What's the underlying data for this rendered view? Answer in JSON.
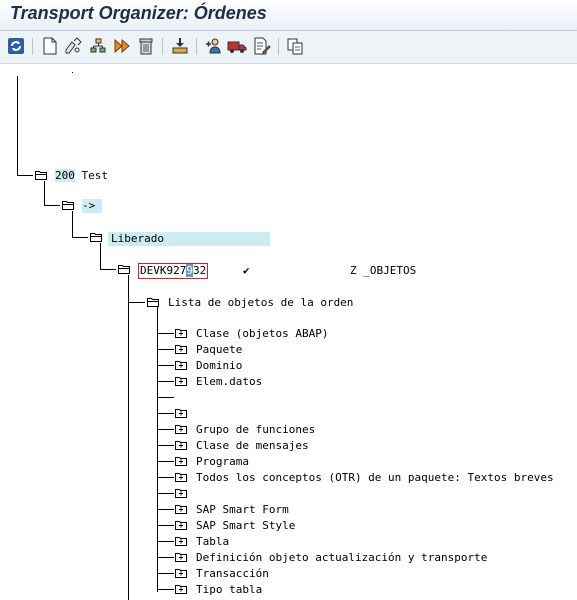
{
  "window": {
    "title": "Transport Organizer: Órdenes"
  },
  "toolbar": [
    {
      "name": "refresh-icon"
    },
    {
      "name": "new-document-icon"
    },
    {
      "name": "display-change-icon"
    },
    {
      "name": "hierarchy-icon"
    },
    {
      "name": "release-icon"
    },
    {
      "name": "delete-icon"
    },
    {
      "name": "import-icon"
    },
    {
      "name": "add-user-icon"
    },
    {
      "name": "transport-truck-icon"
    },
    {
      "name": "document-edit-icon"
    },
    {
      "name": "copy-object-icon"
    }
  ],
  "tree": {
    "client": {
      "number": "200",
      "label": "Test"
    },
    "arrow": "->",
    "status": "Liberado",
    "request": {
      "id_prefix": "DEVK927",
      "id_cursor": "9",
      "id_suffix": "32",
      "check": "✔",
      "description": "Z  _OBJETOS"
    },
    "object_list_label": "Lista de objetos de la orden",
    "items": [
      "Clase (objetos ABAP)",
      "Paquete",
      "Dominio",
      "Elem.datos",
      "",
      "",
      "Grupo de funciones",
      "Clase de mensajes",
      "Programa",
      "Todos los conceptos (OTR) de un paquete: Textos breves",
      "",
      "SAP Smart Form",
      "SAP Smart Style",
      "Tabla",
      "Definición objeto actualización y transporte",
      "Transacción",
      "Tipo tabla"
    ]
  },
  "colors": {
    "title": "#1a2f4d",
    "highlight": "#cdebf3",
    "selection_border": "#d42020"
  }
}
